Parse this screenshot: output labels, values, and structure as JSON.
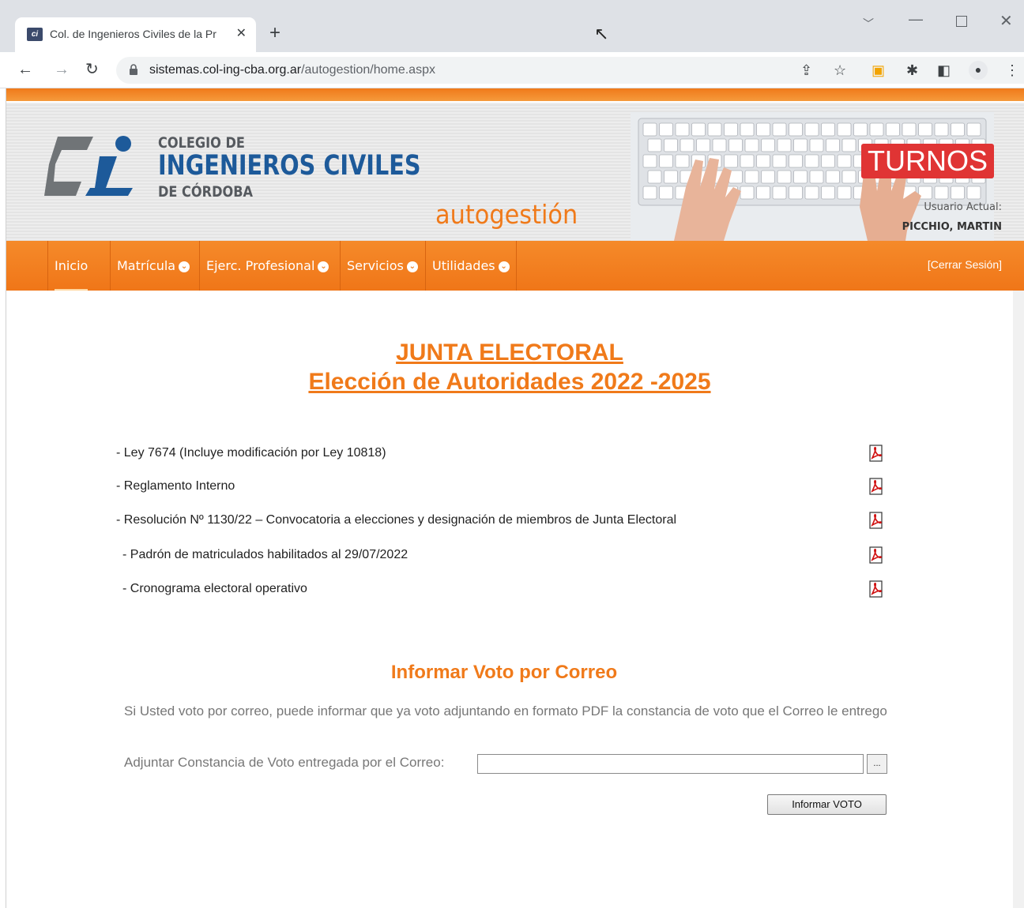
{
  "browser": {
    "tab_title": "Col. de Ingenieros Civiles de la Pr",
    "tab_favicon_text": "ci",
    "url_host": "sistemas.col-ing-cba.org.ar",
    "url_path": "/autogestion/home.aspx"
  },
  "header": {
    "logo_line1": "COLEGIO DE",
    "logo_line2": "INGENIEROS CIVILES",
    "logo_line3": "DE CÓRDOBA",
    "subtitle": "autogestión",
    "turnos": "TURNOS",
    "usuario_label": "Usuario Actual:",
    "usuario_name": "PICCHIO, MARTIN",
    "brand_color": "#f07a1a",
    "logo_color": "#1d5a9a"
  },
  "menu": {
    "items": [
      {
        "label": "Inicio"
      },
      {
        "label": "Matrícula"
      },
      {
        "label": "Ejerc. Profesional"
      },
      {
        "label": "Servicios"
      },
      {
        "label": "Utilidades"
      }
    ],
    "logout": "[Cerrar Sesión]"
  },
  "content": {
    "title1": "JUNTA ELECTORAL",
    "title2": "Elección de Autoridades 2022 -2025",
    "documents": [
      {
        "text": "- Ley 7674 (Incluye modificación por Ley 10818)"
      },
      {
        "text": "- Reglamento Interno"
      },
      {
        "text": "- Resolución Nº 1130/22 – Convocatoria a elecciones y designación de miembros de Junta Electoral"
      },
      {
        "text": " - Padrón de matriculados habilitados al 29/07/2022"
      },
      {
        "text": " - Cronograma electoral operativo"
      }
    ],
    "voto_title": "Informar Voto por Correo",
    "voto_desc": "Si Usted voto por correo, puede informar que ya voto adjuntando en formato PDF la constancia de voto que el Correo le entrego",
    "adjuntar_label": "Adjuntar Constancia de Voto entregada por el Correo:",
    "file_value": "",
    "browse_label": "...",
    "informar_button": "Informar VOTO"
  }
}
